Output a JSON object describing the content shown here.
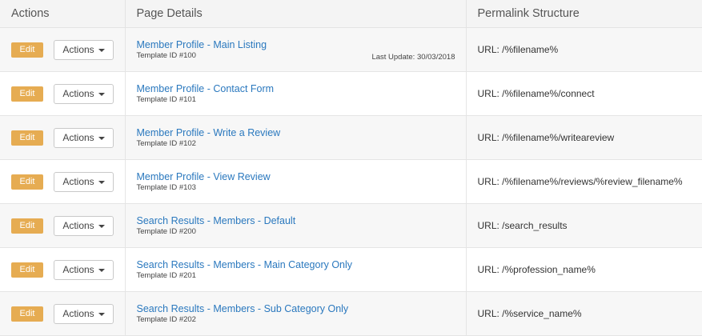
{
  "table": {
    "headers": {
      "actions": "Actions",
      "details": "Page Details",
      "permalink": "Permalink Structure"
    },
    "edit_label": "Edit",
    "actions_label": "Actions",
    "rows": [
      {
        "title": "Member Profile - Main Listing",
        "template_id": "Template ID #100",
        "last_update": "Last Update: 30/03/2018",
        "url": "URL: /%filename%"
      },
      {
        "title": "Member Profile - Contact Form",
        "template_id": "Template ID #101",
        "last_update": "",
        "url": "URL: /%filename%/connect"
      },
      {
        "title": "Member Profile - Write a Review",
        "template_id": "Template ID #102",
        "last_update": "",
        "url": "URL: /%filename%/writeareview"
      },
      {
        "title": "Member Profile - View Review",
        "template_id": "Template ID #103",
        "last_update": "",
        "url": "URL: /%filename%/reviews/%review_filename%"
      },
      {
        "title": "Search Results - Members - Default",
        "template_id": "Template ID #200",
        "last_update": "",
        "url": "URL: /search_results"
      },
      {
        "title": "Search Results - Members - Main Category Only",
        "template_id": "Template ID #201",
        "last_update": "",
        "url": "URL: /%profession_name%"
      },
      {
        "title": "Search Results - Members - Sub Category Only",
        "template_id": "Template ID #202",
        "last_update": "",
        "url": "URL: /%service_name%"
      }
    ]
  },
  "colors": {
    "edit_button": "#e6ac52",
    "link": "#2a78be",
    "header_bg": "#f4f4f4"
  }
}
